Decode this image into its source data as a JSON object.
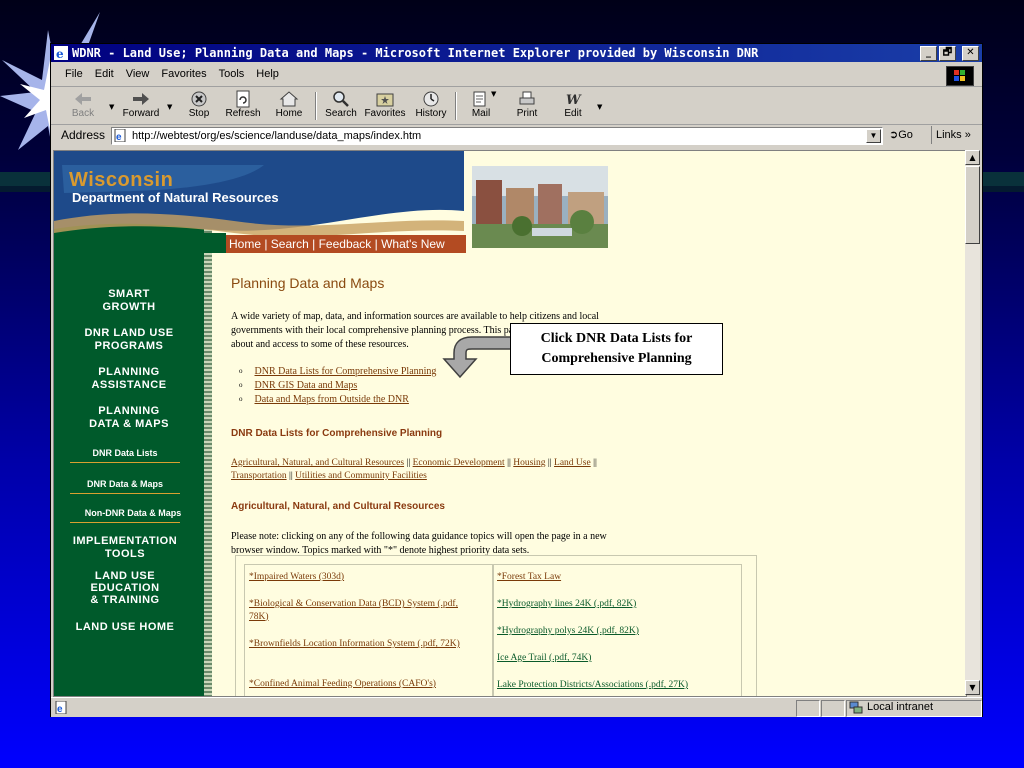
{
  "window": {
    "title": "WDNR - Land Use; Planning Data and Maps - Microsoft Internet Explorer provided by Wisconsin DNR",
    "buttons": {
      "minimize": "_",
      "maximize": "🗗",
      "close": "✕"
    }
  },
  "menu": [
    "File",
    "Edit",
    "View",
    "Favorites",
    "Tools",
    "Help"
  ],
  "toolbar": {
    "back": "Back",
    "forward": "Forward",
    "stop": "Stop",
    "refresh": "Refresh",
    "home": "Home",
    "search": "Search",
    "favorites": "Favorites",
    "history": "History",
    "mail": "Mail",
    "print": "Print",
    "edit": "Edit"
  },
  "address": {
    "label": "Address",
    "url": "http://webtest/org/es/science/landuse/data_maps/index.htm",
    "go": "Go",
    "links": "Links »"
  },
  "page": {
    "header": {
      "wisconsin": "Wisconsin",
      "dnr": "Department of Natural Resources",
      "links": "Home | Search | Feedback | What's New"
    },
    "nav": {
      "smart_growth": [
        "SMART",
        "GROWTH"
      ],
      "land_use_programs": [
        "DNR LAND USE",
        "PROGRAMS"
      ],
      "planning_assistance": [
        "PLANNING",
        "ASSISTANCE"
      ],
      "planning_data_maps": [
        "PLANNING",
        "DATA & MAPS"
      ],
      "sub_data_lists": "DNR Data Lists",
      "sub_data_maps": "DNR Data & Maps",
      "sub_non_dnr": "Non-DNR Data & Maps",
      "implementation_tools": [
        "IMPLEMENTATION",
        "TOOLS"
      ],
      "education": [
        "LAND USE",
        "EDUCATION",
        "& TRAINING"
      ],
      "land_use_home": "LAND USE HOME"
    },
    "title": "Planning Data and Maps",
    "intro": "A wide variety of map, data, and information sources are available to help citizens and local governments with their local comprehensive planning process. This page provides information about and access to some of these resources.",
    "bullets": [
      "DNR Data Lists for Comprehensive Planning",
      "DNR GIS Data and Maps",
      "Data and Maps from Outside the DNR"
    ],
    "section1": "DNR Data Lists for Comprehensive Planning",
    "categories": {
      "agri": "Agricultural, Natural, and Cultural Resources",
      "econ": "Economic Development",
      "housing": "Housing",
      "land": "Land Use",
      "trans": "Transportation",
      "util": "Utilities and Community Facilities",
      "sep": "||"
    },
    "section2": "Agricultural, Natural, and Cultural Resources",
    "note": "Please note: clicking on any of the following data guidance topics will open the page in a new browser window. Topics marked with \"*\" denote highest priority data sets.",
    "left_col": [
      "*Impaired Waters (303d)",
      "*Biological & Conservation Data (BCD) System (.pdf, 78K)",
      "*Brownfields Location Information System (.pdf, 72K)",
      "*Confined Animal Feeding Operations (CAFO's)"
    ],
    "right_col": [
      "*Forest Tax Law",
      "*Hydrography lines 24K (.pdf, 82K)",
      "*Hydrography polys 24K (.pdf, 82K)",
      "Ice Age Trail (.pdf, 74K)",
      "Lake Protection Districts/Associations (.pdf, 27K)"
    ]
  },
  "callout": [
    "Click DNR Data Lists for",
    "Comprehensive Planning"
  ],
  "status": {
    "zone": "Local intranet"
  },
  "colors": {
    "nav_green": "#005a2b",
    "page_bg": "#fffde0",
    "accent_orange": "#b34b22"
  }
}
